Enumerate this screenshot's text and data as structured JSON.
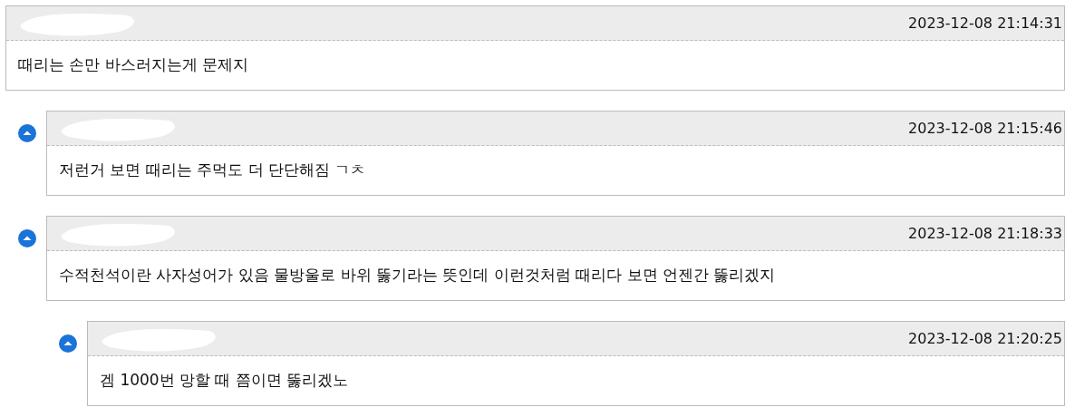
{
  "comments": [
    {
      "timestamp": "2023-12-08 21:14:31",
      "text": "때리는 손만 바스러지는게 문제지",
      "children": [
        {
          "timestamp": "2023-12-08 21:15:46",
          "text": "저런거 보면 때리는 주먹도 더 단단해짐 ㄱㅊ"
        },
        {
          "timestamp": "2023-12-08 21:18:33",
          "text": "수적천석이란 사자성어가 있음 물방울로 바위 뚫기라는 뜻인데 이런것처럼 때리다 보면 언젠간 뚫리겠지",
          "children": [
            {
              "timestamp": "2023-12-08 21:20:25",
              "text": "겜 1000번 망할 때 쯤이면 뚫리겠노"
            }
          ]
        }
      ]
    }
  ]
}
